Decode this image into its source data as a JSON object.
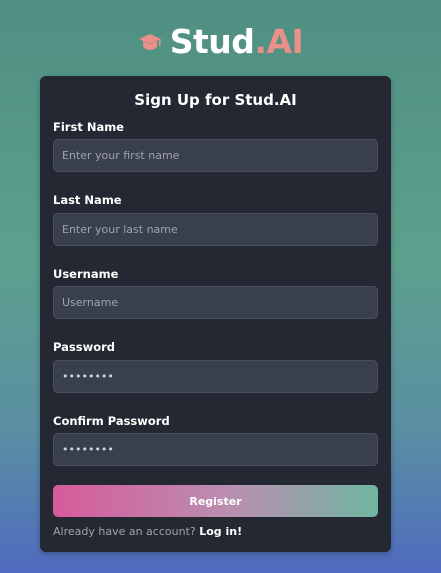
{
  "brand": {
    "name_main": "Stud",
    "name_accent": ".AI",
    "icon": "graduation-cap-icon",
    "accent_color": "#e9908a"
  },
  "form": {
    "title": "Sign Up for Stud.AI",
    "fields": [
      {
        "label": "First Name",
        "placeholder": "Enter your first name",
        "value": ""
      },
      {
        "label": "Last Name",
        "placeholder": "Enter your last name",
        "value": ""
      },
      {
        "label": "Username",
        "placeholder": "Username",
        "value": ""
      },
      {
        "label": "Password",
        "placeholder": "",
        "value": "••••••••"
      },
      {
        "label": "Confirm Password",
        "placeholder": "",
        "value": "••••••••"
      }
    ],
    "register_label": "Register",
    "login_prompt": "Already have an account? ",
    "login_link": "Log in!"
  },
  "colors": {
    "card_bg": "#242832",
    "input_bg": "#3a3f4e",
    "button_gradient_start": "#d65b9b",
    "button_gradient_end": "#6fb6a0"
  }
}
